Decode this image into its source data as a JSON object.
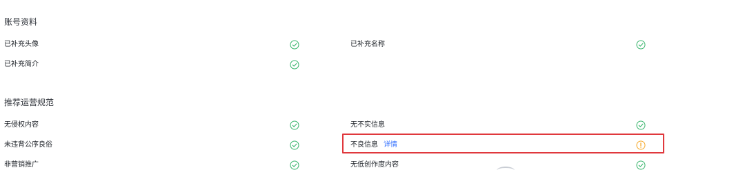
{
  "sections": {
    "account": {
      "title": "账号资料",
      "items": [
        {
          "label": "已补充头像",
          "status": "ok"
        },
        {
          "label": "已补充名称",
          "status": "ok"
        },
        {
          "label": "已补充简介",
          "status": "ok"
        }
      ]
    },
    "recommend": {
      "title": "推荐运营规范",
      "items": [
        {
          "label": "无侵权内容",
          "status": "ok"
        },
        {
          "label": "无不实信息",
          "status": "ok"
        },
        {
          "label": "未违背公序良俗",
          "status": "ok"
        },
        {
          "label": "不良信息",
          "status": "warning",
          "link": "详情"
        },
        {
          "label": "非营销推广",
          "status": "ok"
        },
        {
          "label": "无低创作度内容",
          "status": "ok"
        }
      ]
    }
  },
  "icons": {
    "ok": "check-circle-icon",
    "warning": "exclamation-circle-icon"
  },
  "colors": {
    "ok": "#35b46a",
    "warning": "#f5a623",
    "link": "#3370ff",
    "highlight": "#e0383d"
  }
}
